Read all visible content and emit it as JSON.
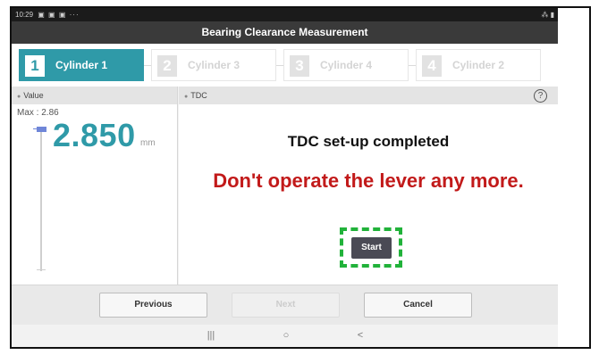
{
  "status_bar": {
    "time": "10:29",
    "icons": "▣ ▣ ▣ ···",
    "right": "⁂ ▮"
  },
  "title": "Bearing Clearance Measurement",
  "steps": [
    {
      "number": "1",
      "label": "Cylinder 1",
      "active": true
    },
    {
      "number": "2",
      "label": "Cylinder 3",
      "active": false
    },
    {
      "number": "3",
      "label": "Cylinder 4",
      "active": false
    },
    {
      "number": "4",
      "label": "Cylinder 2",
      "active": false
    }
  ],
  "value_panel": {
    "header": "Value",
    "max_label": "Max : 2.86",
    "value": "2.850",
    "unit": "mm"
  },
  "tdc_panel": {
    "header": "TDC",
    "help": "?",
    "message_main": "TDC set-up completed",
    "message_warning": "Don't operate the lever any more.",
    "start_label": "Start"
  },
  "buttons": {
    "previous": "Previous",
    "next": "Next",
    "cancel": "Cancel"
  },
  "nav": {
    "recent": "|||",
    "home": "○",
    "back": "<"
  },
  "colors": {
    "accent": "#2f9aa8",
    "warning": "#c21a1a",
    "highlight": "#21b23a",
    "title_bar": "#3a3a3a",
    "start_button": "#4a4a55"
  }
}
